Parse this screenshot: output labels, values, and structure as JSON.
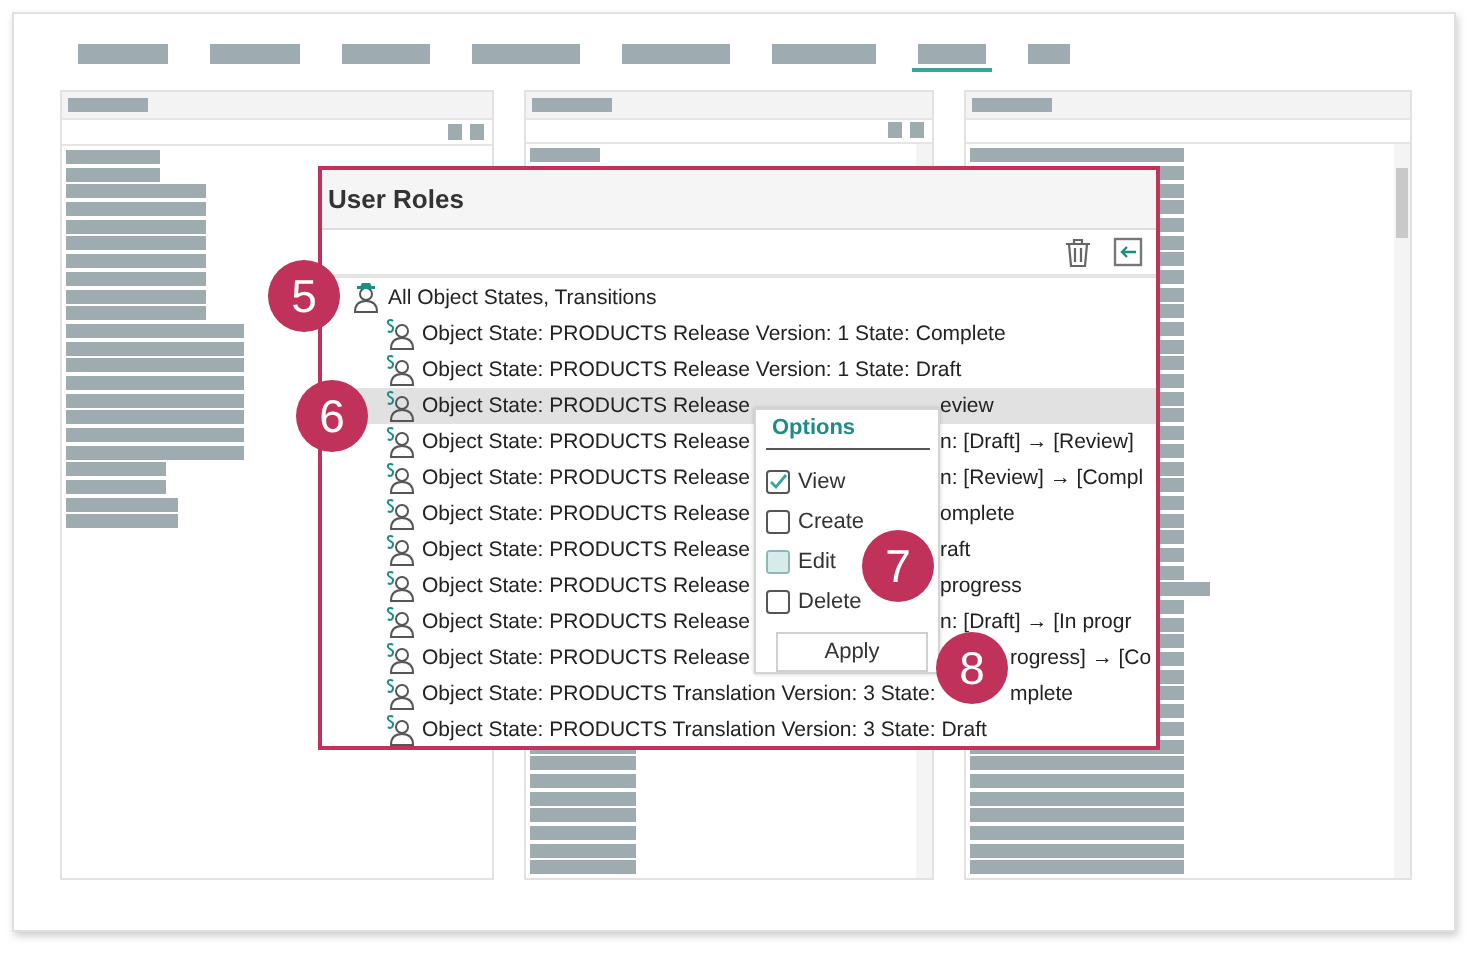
{
  "tabs": [
    {
      "selected": false
    },
    {
      "selected": false
    },
    {
      "selected": false
    },
    {
      "selected": false
    },
    {
      "selected": false
    },
    {
      "selected": false
    },
    {
      "selected": true
    },
    {
      "selected": false
    }
  ],
  "dialog": {
    "title": "User Roles",
    "tree": {
      "label": "All Object States, Transitions",
      "children": [
        {
          "text": "Object State: PRODUCTS Release Version: 1 State: Complete",
          "selected": false
        },
        {
          "text": "Object State: PRODUCTS Release Version: 1 State: Draft",
          "selected": false
        },
        {
          "text": "Object State: PRODUCTS Release",
          "tail": "eview",
          "selected": true
        },
        {
          "text": "Object State: PRODUCTS Release",
          "tail": "n: [Draft] → [Review]",
          "selected": false
        },
        {
          "text": "Object State: PRODUCTS Release",
          "tail": "n: [Review] → [Compl",
          "selected": false
        },
        {
          "text": "Object State: PRODUCTS Release",
          "tail": "omplete",
          "selected": false
        },
        {
          "text": "Object State: PRODUCTS Release",
          "tail": "raft",
          "selected": false
        },
        {
          "text": "Object State: PRODUCTS Release",
          "tail": "progress",
          "selected": false
        },
        {
          "text": "Object State: PRODUCTS Release",
          "tail": "n: [Draft] → [In progr",
          "selected": false
        },
        {
          "text": "Object State: PRODUCTS Release",
          "tail": "rogress] → [Co",
          "selected": false
        },
        {
          "text": "Object State: PRODUCTS Translation Version: 3 State:",
          "tail": "mplete",
          "selected": false
        },
        {
          "text": "Object State: PRODUCTS Translation Version: 3 State: Draft",
          "selected": false
        }
      ]
    }
  },
  "options": {
    "title": "Options",
    "items": [
      {
        "label": "View",
        "checked": true,
        "hovered": false
      },
      {
        "label": "Create",
        "checked": false,
        "hovered": false
      },
      {
        "label": "Edit",
        "checked": false,
        "hovered": true
      },
      {
        "label": "Delete",
        "checked": false,
        "hovered": false
      }
    ],
    "button": "Apply"
  },
  "callouts": [
    "5",
    "6",
    "7",
    "8"
  ]
}
